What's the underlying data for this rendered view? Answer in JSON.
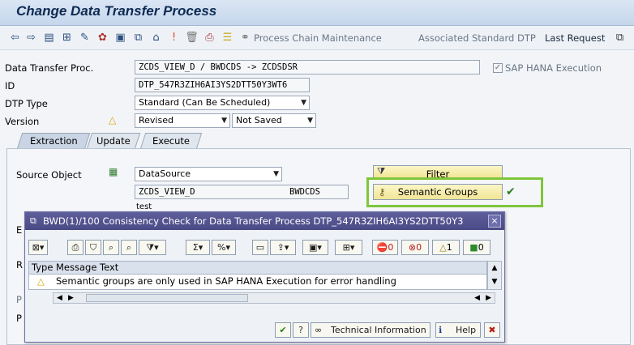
{
  "window": {
    "title": "Change Data Transfer Process"
  },
  "toolbar": {
    "icons": [
      "back-icon",
      "forward-icon",
      "display-icon",
      "hierarchy-icon",
      "edit-icon",
      "activate-icon",
      "check-icon",
      "copy-icon",
      "deploy-icon",
      "info-icon",
      "delete-icon",
      "print-icon",
      "database-icon",
      "chain-icon"
    ],
    "process_chain_maintenance": "Process Chain Maintenance",
    "associated_standard_dtp": "Associated Standard DTP",
    "last_request": "Last Request"
  },
  "header": {
    "dtp_label": "Data Transfer Proc.",
    "dtp_value": "ZCDS_VIEW_D / BWDCDS -> ZCDSDSR",
    "hana_label": "SAP HANA Execution",
    "hana_checked": true,
    "id_label": "ID",
    "id_value": "DTP_547R3ZIH6AI3YS2DTT50Y3WT6",
    "type_label": "DTP Type",
    "type_value": "Standard (Can Be Scheduled)",
    "version_label": "Version",
    "version_value": "Revised",
    "version_status": "Not Saved"
  },
  "tabs": [
    {
      "label": "Extraction",
      "active": true
    },
    {
      "label": "Update",
      "active": false
    },
    {
      "label": "Execute",
      "active": false
    }
  ],
  "extraction": {
    "source_object_label": "Source Object",
    "source_object_value": "DataSource",
    "source_name": "ZCDS_VIEW_D",
    "source_system": "BWDCDS",
    "partial_text": "test",
    "filter_button": "Filter",
    "semantic_groups_button": "Semantic Groups"
  },
  "dialog": {
    "title": "BWD(1)/100 Consistency Check for Data Transfer Process DTP_547R3ZIH6AI3YS2DTT50Y3",
    "counts": {
      "stop": "0",
      "error": "0",
      "warning": "1",
      "success": "0"
    },
    "columns": [
      "Type",
      "Message Text"
    ],
    "rows": [
      {
        "type": "warning",
        "text": "Semantic groups are only used in SAP HANA Execution for error handling"
      }
    ],
    "technical_information": "Technical Information",
    "help": "Help"
  },
  "hidden_labels": {
    "e": "E",
    "r": "R",
    "p": "P",
    "p2": "P"
  },
  "colors": {
    "accent_green": "#7ec63b",
    "title_blue": "#0c2a52",
    "dialog_header": "#4a4a86"
  }
}
